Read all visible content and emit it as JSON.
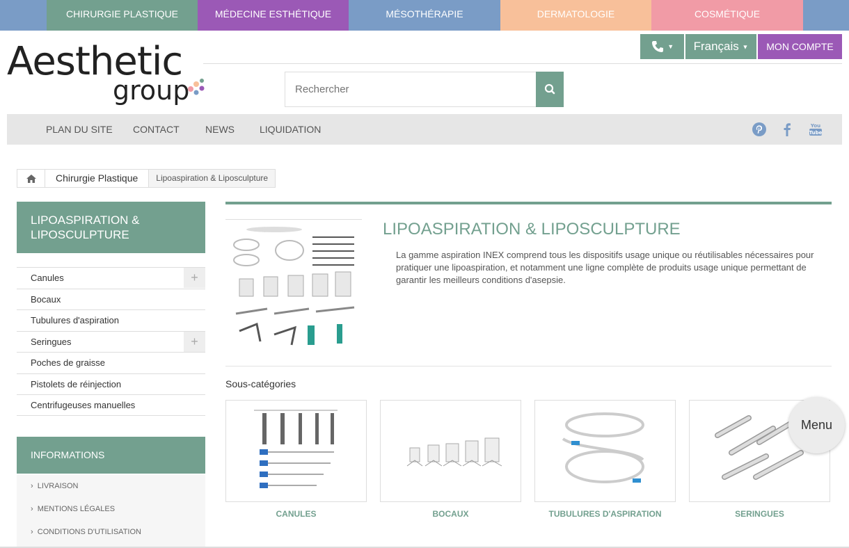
{
  "categories": [
    "CHIRURGIE PLASTIQUE",
    "MÉDECINE ESTHÉTIQUE",
    "MÉSOTHÉRAPIE",
    "DERMATOLOGIE",
    "COSMÉTIQUE"
  ],
  "logo": {
    "line1": "Aesthetic",
    "line2": "group"
  },
  "header": {
    "language": "Français",
    "account": "MON COMPTE"
  },
  "search": {
    "placeholder": "Rechercher"
  },
  "nav": {
    "items": [
      "PLAN DU SITE",
      "CONTACT",
      "NEWS",
      "LIQUIDATION"
    ]
  },
  "breadcrumb": {
    "level1": "Chirurgie Plastique",
    "level2": "Lipoaspiration & Liposculpture"
  },
  "sidebar": {
    "title": "LIPOASPIRATION & LIPOSCULPTURE",
    "items": [
      "Canules",
      "Bocaux",
      "Tubulures d'aspiration",
      "Seringues",
      "Poches de graisse",
      "Pistolets de réinjection",
      "Centrifugeuses manuelles"
    ],
    "info_title": "INFORMATIONS",
    "info_items": [
      "LIVRAISON",
      "MENTIONS LÉGALES",
      "CONDITIONS D'UTILISATION"
    ]
  },
  "main": {
    "title": "LIPOASPIRATION & LIPOSCULPTURE",
    "description": "La gamme aspiration INEX comprend tous les dispositifs usage unique ou réutilisables nécessaires pour pratiquer une lipoaspiration, et notamment une ligne complète de produits usage unique permettant de garantir les meilleurs conditions d'asepsie.",
    "subcategories_label": "Sous-catégories",
    "subcategories": [
      "CANULES",
      "BOCAUX",
      "TUBULURES D'ASPIRATION",
      "SERINGUES"
    ]
  },
  "menu_button": "Menu",
  "colors": {
    "green": "#73a08f",
    "purple": "#9b59b6",
    "blue": "#7a9cc6",
    "peach": "#f8c09a",
    "pink": "#f19ba6"
  }
}
